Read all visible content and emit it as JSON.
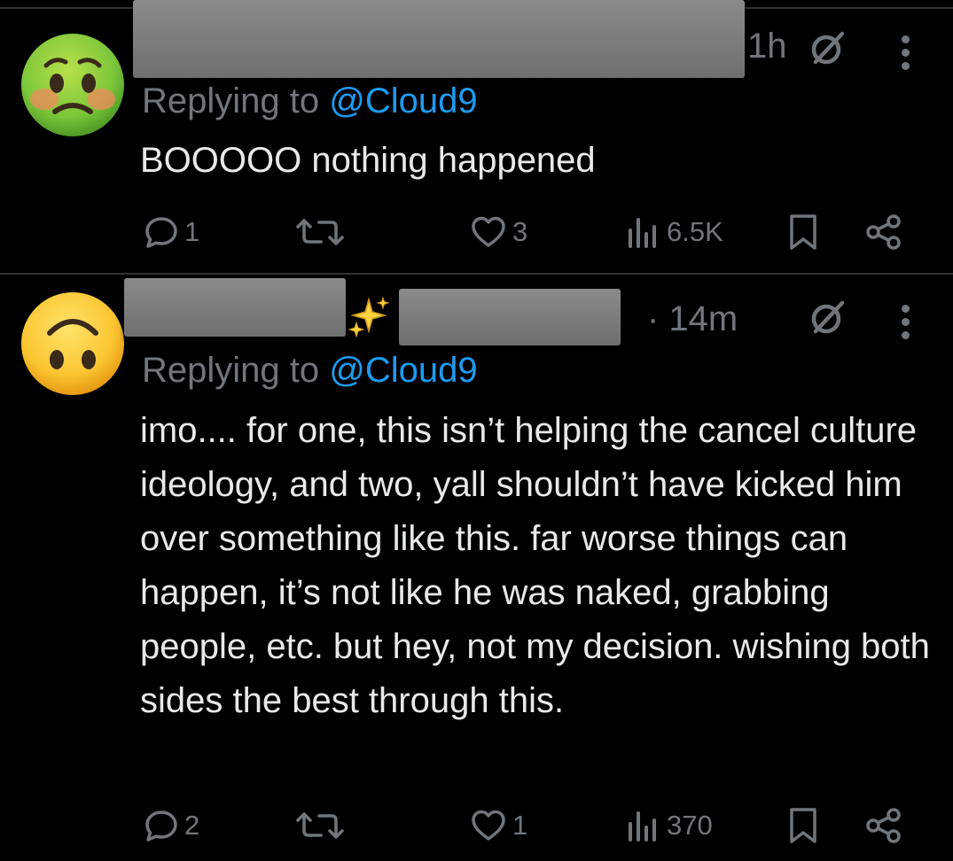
{
  "tweets": [
    {
      "avatar": "nauseated-face-emoji",
      "time": "1h",
      "reply_prefix": "Replying to ",
      "reply_handle": "@Cloud9",
      "text": "BOOOOO nothing happened",
      "replies": "1",
      "likes": "3",
      "views": "6.5K"
    },
    {
      "avatar": "upside-down-face-emoji",
      "time": "· 14m",
      "reply_prefix": "Replying to ",
      "reply_handle": "@Cloud9",
      "text": "imo.... for one, this isn’t helping the cancel culture ideology, and two, yall shouldn’t have kicked him over something like this. far worse things can happen, it’s not like he was naked, grabbing people, etc. but hey, not my decision. wishing both sides the best through this.",
      "replies": "2",
      "likes": "1",
      "views": "370"
    }
  ],
  "colors": {
    "background": "#000000",
    "text": "#e7e9ea",
    "muted": "#71767b",
    "link": "#1d9bf0"
  },
  "icons": [
    "reply-icon",
    "retweet-icon",
    "like-icon",
    "views-icon",
    "bookmark-icon",
    "share-icon",
    "grok-icon",
    "more-icon",
    "sparkles-icon"
  ]
}
